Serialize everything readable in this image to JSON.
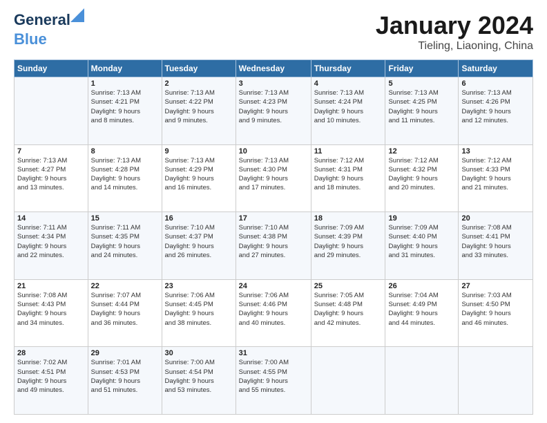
{
  "logo": {
    "line1": "General",
    "line2": "Blue"
  },
  "title": "January 2024",
  "subtitle": "Tieling, Liaoning, China",
  "days_of_week": [
    "Sunday",
    "Monday",
    "Tuesday",
    "Wednesday",
    "Thursday",
    "Friday",
    "Saturday"
  ],
  "weeks": [
    [
      {
        "num": "",
        "info": ""
      },
      {
        "num": "1",
        "info": "Sunrise: 7:13 AM\nSunset: 4:21 PM\nDaylight: 9 hours\nand 8 minutes."
      },
      {
        "num": "2",
        "info": "Sunrise: 7:13 AM\nSunset: 4:22 PM\nDaylight: 9 hours\nand 9 minutes."
      },
      {
        "num": "3",
        "info": "Sunrise: 7:13 AM\nSunset: 4:23 PM\nDaylight: 9 hours\nand 9 minutes."
      },
      {
        "num": "4",
        "info": "Sunrise: 7:13 AM\nSunset: 4:24 PM\nDaylight: 9 hours\nand 10 minutes."
      },
      {
        "num": "5",
        "info": "Sunrise: 7:13 AM\nSunset: 4:25 PM\nDaylight: 9 hours\nand 11 minutes."
      },
      {
        "num": "6",
        "info": "Sunrise: 7:13 AM\nSunset: 4:26 PM\nDaylight: 9 hours\nand 12 minutes."
      }
    ],
    [
      {
        "num": "7",
        "info": "Sunrise: 7:13 AM\nSunset: 4:27 PM\nDaylight: 9 hours\nand 13 minutes."
      },
      {
        "num": "8",
        "info": "Sunrise: 7:13 AM\nSunset: 4:28 PM\nDaylight: 9 hours\nand 14 minutes."
      },
      {
        "num": "9",
        "info": "Sunrise: 7:13 AM\nSunset: 4:29 PM\nDaylight: 9 hours\nand 16 minutes."
      },
      {
        "num": "10",
        "info": "Sunrise: 7:13 AM\nSunset: 4:30 PM\nDaylight: 9 hours\nand 17 minutes."
      },
      {
        "num": "11",
        "info": "Sunrise: 7:12 AM\nSunset: 4:31 PM\nDaylight: 9 hours\nand 18 minutes."
      },
      {
        "num": "12",
        "info": "Sunrise: 7:12 AM\nSunset: 4:32 PM\nDaylight: 9 hours\nand 20 minutes."
      },
      {
        "num": "13",
        "info": "Sunrise: 7:12 AM\nSunset: 4:33 PM\nDaylight: 9 hours\nand 21 minutes."
      }
    ],
    [
      {
        "num": "14",
        "info": "Sunrise: 7:11 AM\nSunset: 4:34 PM\nDaylight: 9 hours\nand 22 minutes."
      },
      {
        "num": "15",
        "info": "Sunrise: 7:11 AM\nSunset: 4:35 PM\nDaylight: 9 hours\nand 24 minutes."
      },
      {
        "num": "16",
        "info": "Sunrise: 7:10 AM\nSunset: 4:37 PM\nDaylight: 9 hours\nand 26 minutes."
      },
      {
        "num": "17",
        "info": "Sunrise: 7:10 AM\nSunset: 4:38 PM\nDaylight: 9 hours\nand 27 minutes."
      },
      {
        "num": "18",
        "info": "Sunrise: 7:09 AM\nSunset: 4:39 PM\nDaylight: 9 hours\nand 29 minutes."
      },
      {
        "num": "19",
        "info": "Sunrise: 7:09 AM\nSunset: 4:40 PM\nDaylight: 9 hours\nand 31 minutes."
      },
      {
        "num": "20",
        "info": "Sunrise: 7:08 AM\nSunset: 4:41 PM\nDaylight: 9 hours\nand 33 minutes."
      }
    ],
    [
      {
        "num": "21",
        "info": "Sunrise: 7:08 AM\nSunset: 4:43 PM\nDaylight: 9 hours\nand 34 minutes."
      },
      {
        "num": "22",
        "info": "Sunrise: 7:07 AM\nSunset: 4:44 PM\nDaylight: 9 hours\nand 36 minutes."
      },
      {
        "num": "23",
        "info": "Sunrise: 7:06 AM\nSunset: 4:45 PM\nDaylight: 9 hours\nand 38 minutes."
      },
      {
        "num": "24",
        "info": "Sunrise: 7:06 AM\nSunset: 4:46 PM\nDaylight: 9 hours\nand 40 minutes."
      },
      {
        "num": "25",
        "info": "Sunrise: 7:05 AM\nSunset: 4:48 PM\nDaylight: 9 hours\nand 42 minutes."
      },
      {
        "num": "26",
        "info": "Sunrise: 7:04 AM\nSunset: 4:49 PM\nDaylight: 9 hours\nand 44 minutes."
      },
      {
        "num": "27",
        "info": "Sunrise: 7:03 AM\nSunset: 4:50 PM\nDaylight: 9 hours\nand 46 minutes."
      }
    ],
    [
      {
        "num": "28",
        "info": "Sunrise: 7:02 AM\nSunset: 4:51 PM\nDaylight: 9 hours\nand 49 minutes."
      },
      {
        "num": "29",
        "info": "Sunrise: 7:01 AM\nSunset: 4:53 PM\nDaylight: 9 hours\nand 51 minutes."
      },
      {
        "num": "30",
        "info": "Sunrise: 7:00 AM\nSunset: 4:54 PM\nDaylight: 9 hours\nand 53 minutes."
      },
      {
        "num": "31",
        "info": "Sunrise: 7:00 AM\nSunset: 4:55 PM\nDaylight: 9 hours\nand 55 minutes."
      },
      {
        "num": "",
        "info": ""
      },
      {
        "num": "",
        "info": ""
      },
      {
        "num": "",
        "info": ""
      }
    ]
  ]
}
